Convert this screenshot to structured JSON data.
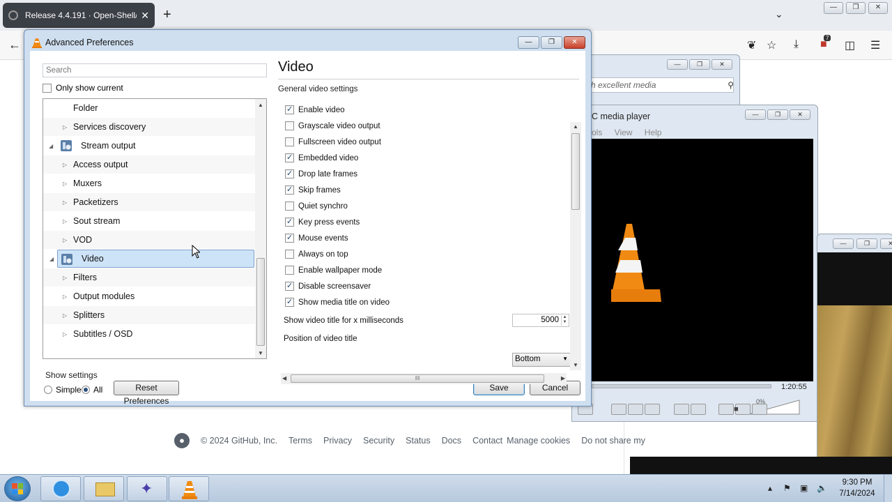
{
  "browser": {
    "tab_title": "Release 4.4.191 · Open-Shell/Op",
    "tab_close": "✕",
    "new_tab": "+",
    "tab_list_icon": "chevron-down-icon",
    "extension_badge": "7"
  },
  "page": {
    "footer": {
      "copyright": "© 2024 GitHub, Inc.",
      "links": [
        "Terms",
        "Privacy",
        "Security",
        "Status",
        "Docs",
        "Contact",
        "Manage cookies",
        "Do not share my"
      ]
    }
  },
  "vlc_bg": {
    "search_placeholder": "h excellent media",
    "player_title": "C media player",
    "menu_items": "ols View Help",
    "time": "1:20:55",
    "volume": "0%"
  },
  "dialog": {
    "title": "Advanced Preferences",
    "search_placeholder": "Search",
    "only_show_current": "Only show current",
    "tree": [
      {
        "label": "Folder",
        "level": 1,
        "expander": "",
        "icon": false
      },
      {
        "label": "Services discovery",
        "level": 1,
        "expander": "▷",
        "icon": false
      },
      {
        "label": "Stream output",
        "level": 0,
        "expander": "◢",
        "icon": true
      },
      {
        "label": "Access output",
        "level": 1,
        "expander": "▷",
        "icon": false
      },
      {
        "label": "Muxers",
        "level": 1,
        "expander": "▷",
        "icon": false
      },
      {
        "label": "Packetizers",
        "level": 1,
        "expander": "▷",
        "icon": false
      },
      {
        "label": "Sout stream",
        "level": 1,
        "expander": "▷",
        "icon": false
      },
      {
        "label": "VOD",
        "level": 1,
        "expander": "▷",
        "icon": false
      },
      {
        "label": "Video",
        "level": 0,
        "expander": "◢",
        "icon": true,
        "selected": true
      },
      {
        "label": "Filters",
        "level": 1,
        "expander": "▷",
        "icon": false
      },
      {
        "label": "Output modules",
        "level": 1,
        "expander": "▷",
        "icon": false
      },
      {
        "label": "Splitters",
        "level": 1,
        "expander": "▷",
        "icon": false
      },
      {
        "label": "Subtitles / OSD",
        "level": 1,
        "expander": "▷",
        "icon": false
      }
    ],
    "show_settings": {
      "legend": "Show settings",
      "simple": "Simple",
      "all": "All",
      "selected": "All"
    },
    "reset_button": "Reset Preferences",
    "save_button": "Save",
    "cancel_button": "Cancel",
    "panel": {
      "title": "Video",
      "section": "General video settings",
      "options": [
        {
          "label": "Enable video",
          "checked": true
        },
        {
          "label": "Grayscale video output",
          "checked": false
        },
        {
          "label": "Fullscreen video output",
          "checked": false
        },
        {
          "label": "Embedded video",
          "checked": true
        },
        {
          "label": "Drop late frames",
          "checked": true
        },
        {
          "label": "Skip frames",
          "checked": true
        },
        {
          "label": "Quiet synchro",
          "checked": false
        },
        {
          "label": "Key press events",
          "checked": true
        },
        {
          "label": "Mouse events",
          "checked": true
        },
        {
          "label": "Always on top",
          "checked": false
        },
        {
          "label": "Enable wallpaper mode",
          "checked": false
        },
        {
          "label": "Disable screensaver",
          "checked": true
        },
        {
          "label": "Show media title on video",
          "checked": true
        }
      ],
      "title_ms_label": "Show video title for x milliseconds",
      "title_ms_value": "5000",
      "title_pos_label": "Position of video title",
      "title_pos_value": "Bottom"
    }
  },
  "taskbar": {
    "time": "9:30 PM",
    "date": "7/14/2024"
  }
}
